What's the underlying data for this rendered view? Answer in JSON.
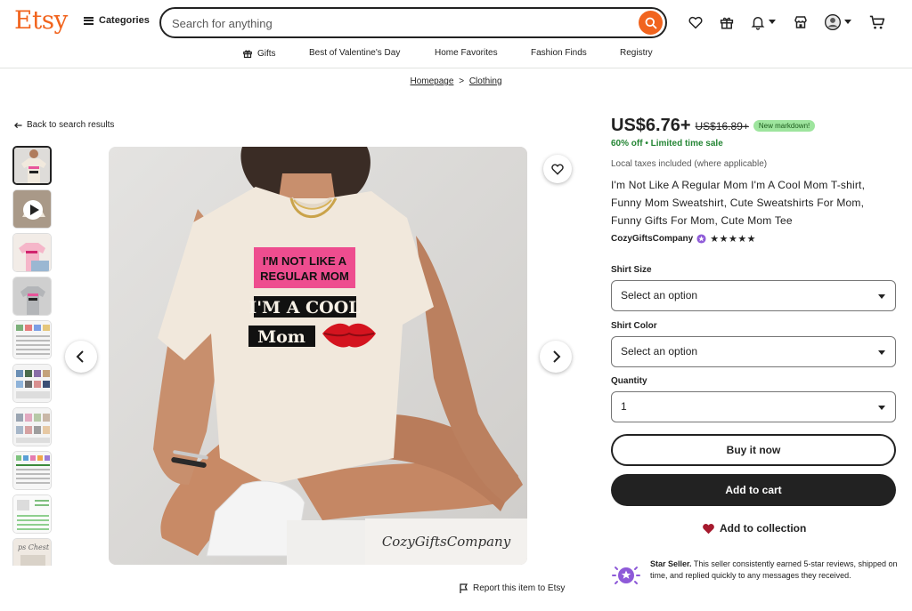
{
  "header": {
    "logo": "Etsy",
    "categories_label": "Categories",
    "search_placeholder": "Search for anything"
  },
  "subnav": [
    "Gifts",
    "Best of Valentine's Day",
    "Home Favorites",
    "Fashion Finds",
    "Registry"
  ],
  "breadcrumb": {
    "home": "Homepage",
    "separator": ">",
    "current": "Clothing"
  },
  "back_link": "Back to search results",
  "image": {
    "shirt_text_line1": "I'M NOT LIKE A",
    "shirt_text_line2": "REGULAR MOM",
    "shirt_text_line3": "I'M A COOL",
    "shirt_text_line4": "Mom",
    "watermark": "CozyGiftsCompany"
  },
  "report_link": "Report this item to Etsy",
  "product": {
    "price": "US$6.76+",
    "original_price": "US$16.89+",
    "markdown_badge": "New markdown!",
    "discount": "60% off • Limited time sale",
    "tax_note": "Local taxes included (where applicable)",
    "title": "I'm Not Like A Regular Mom I'm A Cool Mom T-shirt, Funny Mom Sweatshirt, Cute Sweatshirts For Mom, Funny Gifts For Mom, Cute Mom Tee",
    "shop_name": "CozyGiftsCompany",
    "rating_stars": "★★★★★"
  },
  "options": {
    "size_label": "Shirt Size",
    "size_value": "Select an option",
    "color_label": "Shirt Color",
    "color_value": "Select an option",
    "quantity_label": "Quantity",
    "quantity_value": "1"
  },
  "actions": {
    "buy_now": "Buy it now",
    "add_to_cart": "Add to cart",
    "add_to_collection": "Add to collection"
  },
  "star_seller": {
    "title": "Star Seller.",
    "text": "This seller consistently earned 5-star reviews, shipped on time, and replied quickly to any messages they received."
  },
  "colors": {
    "brand": "#F1641E",
    "sale_green": "#258635",
    "badge_green": "#9EE59E",
    "heart": "#A61A2E"
  }
}
